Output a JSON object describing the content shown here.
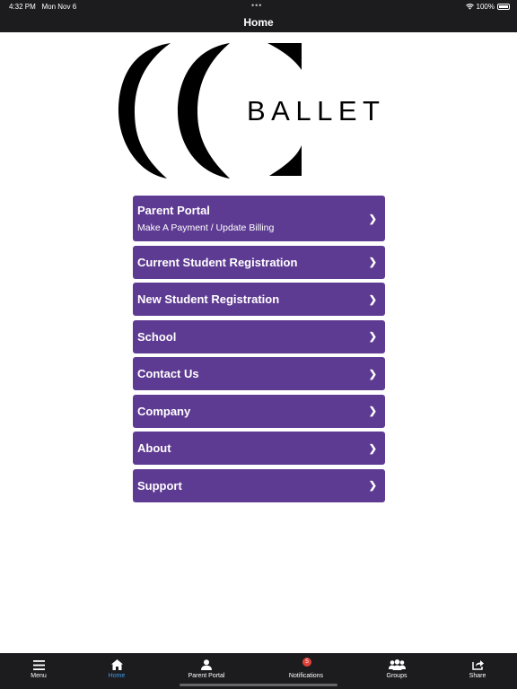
{
  "status_bar": {
    "time": "4:32 PM",
    "date": "Mon Nov 6",
    "battery": "100%"
  },
  "nav": {
    "title": "Home"
  },
  "logo": {
    "wordmark": "BALLET"
  },
  "menu": [
    {
      "label": "Parent Portal",
      "sub": "Make A Payment / Update Billing"
    },
    {
      "label": "Current Student Registration"
    },
    {
      "label": "New Student Registration"
    },
    {
      "label": "School"
    },
    {
      "label": "Contact Us"
    },
    {
      "label": "Company"
    },
    {
      "label": "About"
    },
    {
      "label": "Support"
    }
  ],
  "chevron": "❯",
  "tabs": [
    {
      "label": "Menu",
      "icon": "hamburger-icon"
    },
    {
      "label": "Home",
      "icon": "home-icon",
      "active": true
    },
    {
      "label": "Parent Portal",
      "icon": "person-icon"
    },
    {
      "label": "Notifications",
      "icon": "bell-icon",
      "badge": "5"
    },
    {
      "label": "Groups",
      "icon": "groups-icon"
    },
    {
      "label": "Share",
      "icon": "share-icon"
    }
  ],
  "colors": {
    "accent": "#5e3b92",
    "bar": "#1c1c1e",
    "active_tab": "#3d9df3",
    "badge": "#e0413a"
  }
}
